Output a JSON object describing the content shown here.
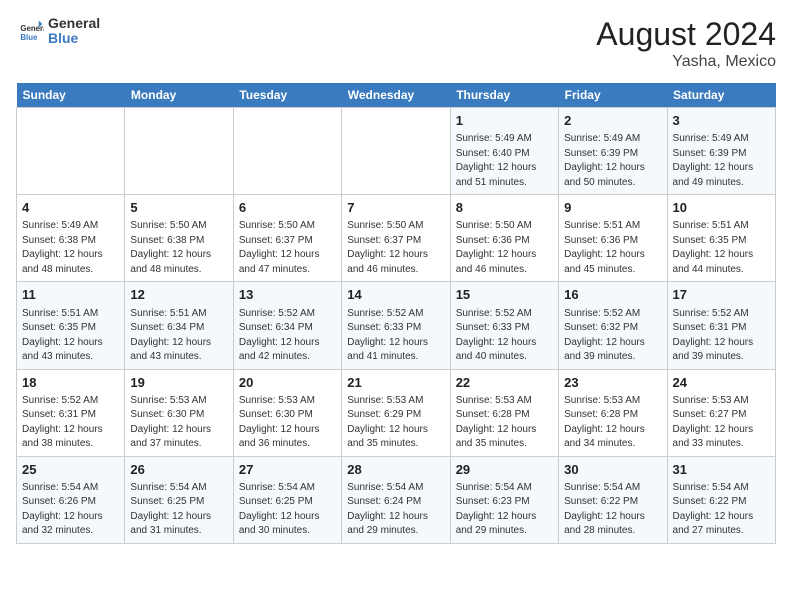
{
  "header": {
    "logo_general": "General",
    "logo_blue": "Blue",
    "title": "August 2024",
    "subtitle": "Yasha, Mexico"
  },
  "days_of_week": [
    "Sunday",
    "Monday",
    "Tuesday",
    "Wednesday",
    "Thursday",
    "Friday",
    "Saturday"
  ],
  "weeks": [
    [
      {
        "num": "",
        "info": ""
      },
      {
        "num": "",
        "info": ""
      },
      {
        "num": "",
        "info": ""
      },
      {
        "num": "",
        "info": ""
      },
      {
        "num": "1",
        "info": "Sunrise: 5:49 AM\nSunset: 6:40 PM\nDaylight: 12 hours\nand 51 minutes."
      },
      {
        "num": "2",
        "info": "Sunrise: 5:49 AM\nSunset: 6:39 PM\nDaylight: 12 hours\nand 50 minutes."
      },
      {
        "num": "3",
        "info": "Sunrise: 5:49 AM\nSunset: 6:39 PM\nDaylight: 12 hours\nand 49 minutes."
      }
    ],
    [
      {
        "num": "4",
        "info": "Sunrise: 5:49 AM\nSunset: 6:38 PM\nDaylight: 12 hours\nand 48 minutes."
      },
      {
        "num": "5",
        "info": "Sunrise: 5:50 AM\nSunset: 6:38 PM\nDaylight: 12 hours\nand 48 minutes."
      },
      {
        "num": "6",
        "info": "Sunrise: 5:50 AM\nSunset: 6:37 PM\nDaylight: 12 hours\nand 47 minutes."
      },
      {
        "num": "7",
        "info": "Sunrise: 5:50 AM\nSunset: 6:37 PM\nDaylight: 12 hours\nand 46 minutes."
      },
      {
        "num": "8",
        "info": "Sunrise: 5:50 AM\nSunset: 6:36 PM\nDaylight: 12 hours\nand 46 minutes."
      },
      {
        "num": "9",
        "info": "Sunrise: 5:51 AM\nSunset: 6:36 PM\nDaylight: 12 hours\nand 45 minutes."
      },
      {
        "num": "10",
        "info": "Sunrise: 5:51 AM\nSunset: 6:35 PM\nDaylight: 12 hours\nand 44 minutes."
      }
    ],
    [
      {
        "num": "11",
        "info": "Sunrise: 5:51 AM\nSunset: 6:35 PM\nDaylight: 12 hours\nand 43 minutes."
      },
      {
        "num": "12",
        "info": "Sunrise: 5:51 AM\nSunset: 6:34 PM\nDaylight: 12 hours\nand 43 minutes."
      },
      {
        "num": "13",
        "info": "Sunrise: 5:52 AM\nSunset: 6:34 PM\nDaylight: 12 hours\nand 42 minutes."
      },
      {
        "num": "14",
        "info": "Sunrise: 5:52 AM\nSunset: 6:33 PM\nDaylight: 12 hours\nand 41 minutes."
      },
      {
        "num": "15",
        "info": "Sunrise: 5:52 AM\nSunset: 6:33 PM\nDaylight: 12 hours\nand 40 minutes."
      },
      {
        "num": "16",
        "info": "Sunrise: 5:52 AM\nSunset: 6:32 PM\nDaylight: 12 hours\nand 39 minutes."
      },
      {
        "num": "17",
        "info": "Sunrise: 5:52 AM\nSunset: 6:31 PM\nDaylight: 12 hours\nand 39 minutes."
      }
    ],
    [
      {
        "num": "18",
        "info": "Sunrise: 5:52 AM\nSunset: 6:31 PM\nDaylight: 12 hours\nand 38 minutes."
      },
      {
        "num": "19",
        "info": "Sunrise: 5:53 AM\nSunset: 6:30 PM\nDaylight: 12 hours\nand 37 minutes."
      },
      {
        "num": "20",
        "info": "Sunrise: 5:53 AM\nSunset: 6:30 PM\nDaylight: 12 hours\nand 36 minutes."
      },
      {
        "num": "21",
        "info": "Sunrise: 5:53 AM\nSunset: 6:29 PM\nDaylight: 12 hours\nand 35 minutes."
      },
      {
        "num": "22",
        "info": "Sunrise: 5:53 AM\nSunset: 6:28 PM\nDaylight: 12 hours\nand 35 minutes."
      },
      {
        "num": "23",
        "info": "Sunrise: 5:53 AM\nSunset: 6:28 PM\nDaylight: 12 hours\nand 34 minutes."
      },
      {
        "num": "24",
        "info": "Sunrise: 5:53 AM\nSunset: 6:27 PM\nDaylight: 12 hours\nand 33 minutes."
      }
    ],
    [
      {
        "num": "25",
        "info": "Sunrise: 5:54 AM\nSunset: 6:26 PM\nDaylight: 12 hours\nand 32 minutes."
      },
      {
        "num": "26",
        "info": "Sunrise: 5:54 AM\nSunset: 6:25 PM\nDaylight: 12 hours\nand 31 minutes."
      },
      {
        "num": "27",
        "info": "Sunrise: 5:54 AM\nSunset: 6:25 PM\nDaylight: 12 hours\nand 30 minutes."
      },
      {
        "num": "28",
        "info": "Sunrise: 5:54 AM\nSunset: 6:24 PM\nDaylight: 12 hours\nand 29 minutes."
      },
      {
        "num": "29",
        "info": "Sunrise: 5:54 AM\nSunset: 6:23 PM\nDaylight: 12 hours\nand 29 minutes."
      },
      {
        "num": "30",
        "info": "Sunrise: 5:54 AM\nSunset: 6:22 PM\nDaylight: 12 hours\nand 28 minutes."
      },
      {
        "num": "31",
        "info": "Sunrise: 5:54 AM\nSunset: 6:22 PM\nDaylight: 12 hours\nand 27 minutes."
      }
    ]
  ]
}
